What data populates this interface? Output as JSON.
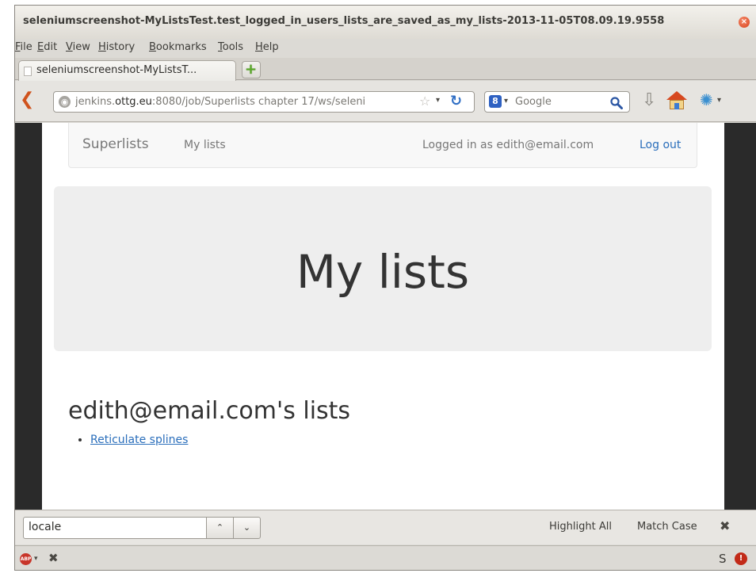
{
  "window": {
    "title": "seleniumscreenshot-MyListsTest.test_logged_in_users_lists_are_saved_as_my_lists-2013-11-05T08.09.19.9558",
    "close_glyph": "×"
  },
  "menu": [
    "File",
    "Edit",
    "View",
    "History",
    "Bookmarks",
    "Tools",
    "Help"
  ],
  "tab": {
    "label": "seleniumscreenshot-MyListsT...",
    "new_tab_glyph": "+"
  },
  "navbar": {
    "back_glyph": "❮",
    "url_prefix": "jenkins.",
    "url_domain": "ottg.eu",
    "url_rest": ":8080/job/Superlists chapter 17/ws/seleni",
    "star_glyph": "☆",
    "dropdown_glyph": "▾",
    "reload_glyph": "↻",
    "search_engine_glyph": "8",
    "search_placeholder": "Google",
    "search_glyph": "🔍",
    "download_glyph": "⇩",
    "addon_glyph": "✺"
  },
  "site": {
    "brand": "Superlists",
    "nav_link": "My lists",
    "logged_in_text": "Logged in as edith@email.com",
    "logout": "Log out",
    "jumbotron_title": "My lists",
    "lists_heading": "edith@email.com's lists",
    "lists": [
      "Reticulate splines"
    ]
  },
  "findbar": {
    "query": "locale",
    "prev_glyph": "⌃",
    "next_glyph": "⌄",
    "highlight_all": "Highlight All",
    "match_case": "Match Case",
    "close_glyph": "✖"
  },
  "statusbar": {
    "abp_label": "ABP",
    "close_glyph": "✖",
    "s_glyph": "S",
    "fb_glyph": "!"
  }
}
